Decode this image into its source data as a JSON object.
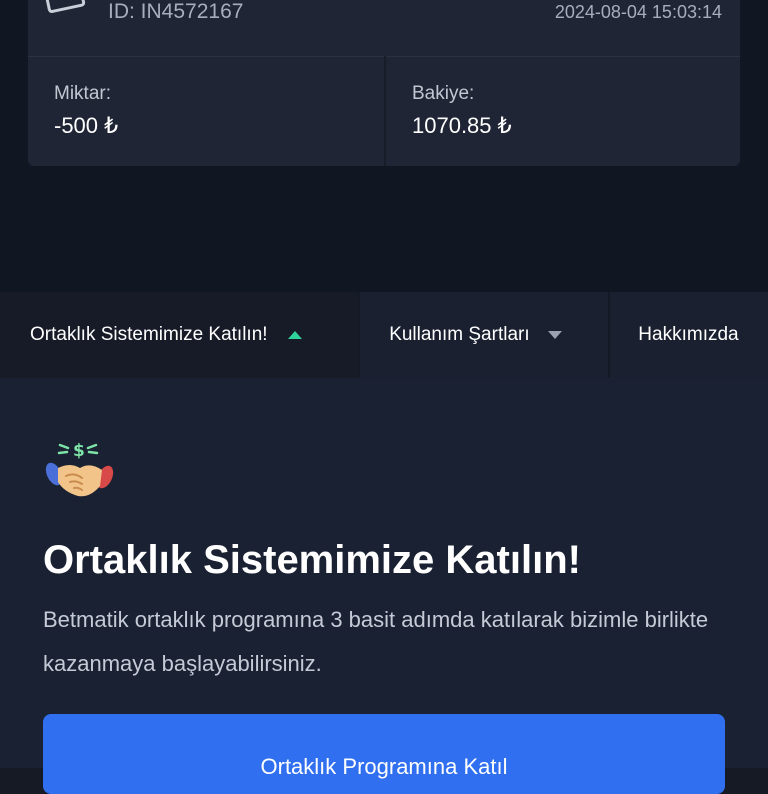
{
  "transaction": {
    "id_text": "ID: IN4572167",
    "datetime": "2024-08-04 15:03:14",
    "amount_label": "Miktar:",
    "amount_value": "-500 ₺",
    "balance_label": "Bakiye:",
    "balance_value": "1070.85 ₺"
  },
  "tabs": [
    {
      "label": "Ortaklık Sistemimize Katılın!",
      "expanded": true
    },
    {
      "label": "Kullanım Şartları",
      "expanded": false
    },
    {
      "label": "Hakkımızda"
    }
  ],
  "affiliate": {
    "icon": "handshake-money-icon",
    "title": "Ortaklık Sistemimize Katılın!",
    "description": "Betmatik ortaklık programına 3 basit adımda katılarak bizimle birlikte kazanmaya başlayabilirsiniz.",
    "button_label": "Ortaklık Programına Katıl"
  },
  "colors": {
    "background": "#151a25",
    "card": "#1f2535",
    "accent_green": "#2fd39a",
    "button_blue": "#2f6ff0"
  }
}
